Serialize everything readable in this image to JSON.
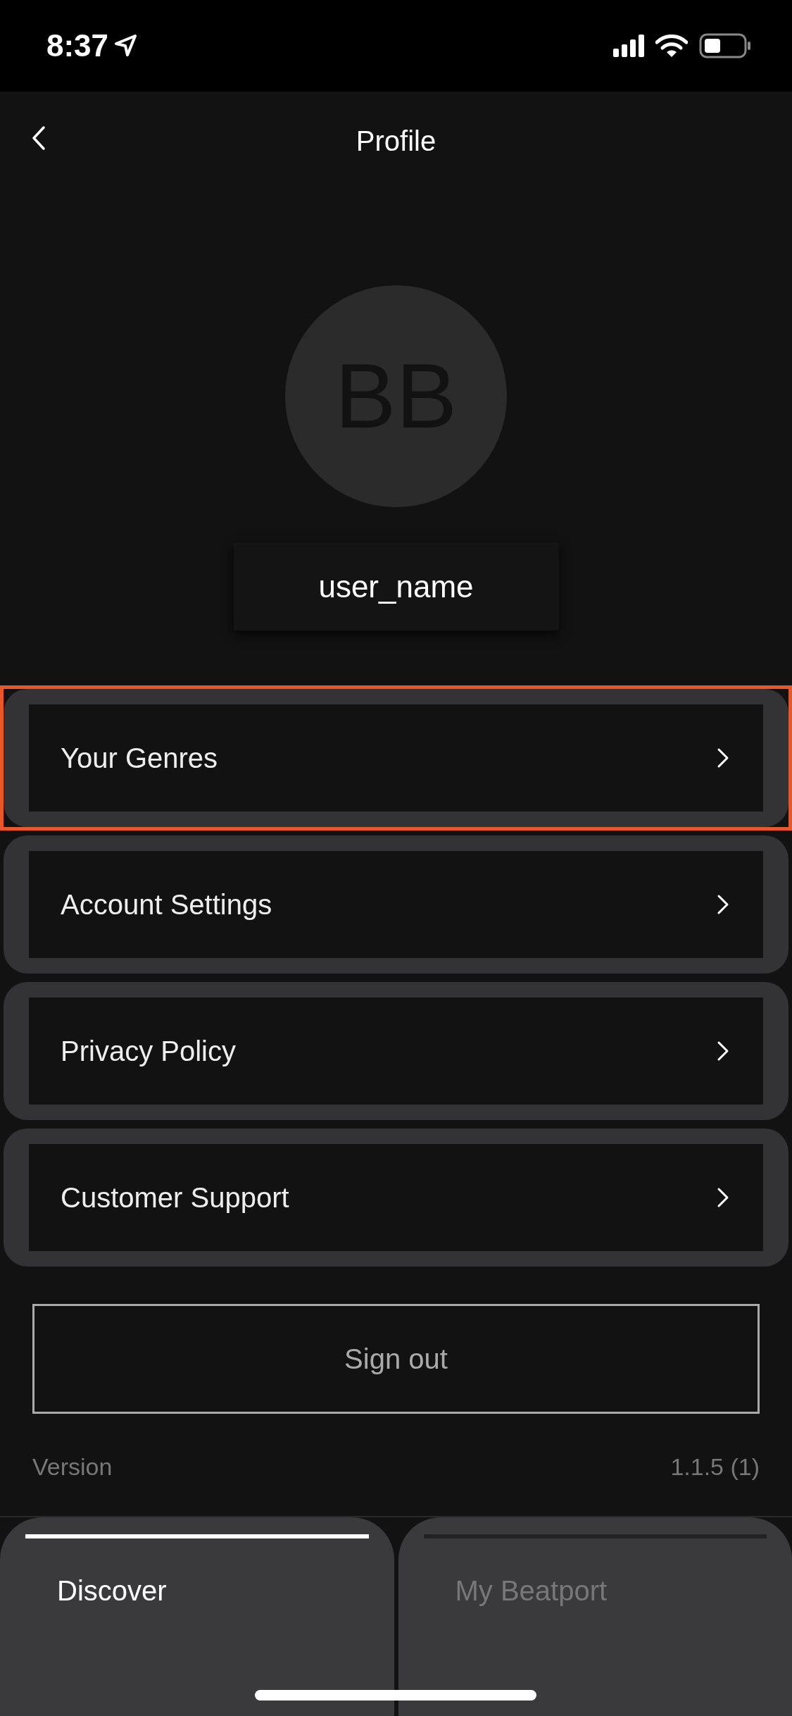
{
  "status_bar": {
    "time": "8:37"
  },
  "header": {
    "title": "Profile"
  },
  "profile": {
    "initials": "BB",
    "username": "user_name"
  },
  "menu": [
    {
      "label": "Your Genres",
      "highlighted": true
    },
    {
      "label": "Account Settings",
      "highlighted": false
    },
    {
      "label": "Privacy Policy",
      "highlighted": false
    },
    {
      "label": "Customer Support",
      "highlighted": false
    }
  ],
  "sign_out": {
    "label": "Sign out"
  },
  "version": {
    "label": "Version",
    "value": "1.1.5 (1)"
  },
  "tabs": [
    {
      "label": "Discover",
      "selected": true
    },
    {
      "label": "My Beatport",
      "selected": false
    }
  ]
}
